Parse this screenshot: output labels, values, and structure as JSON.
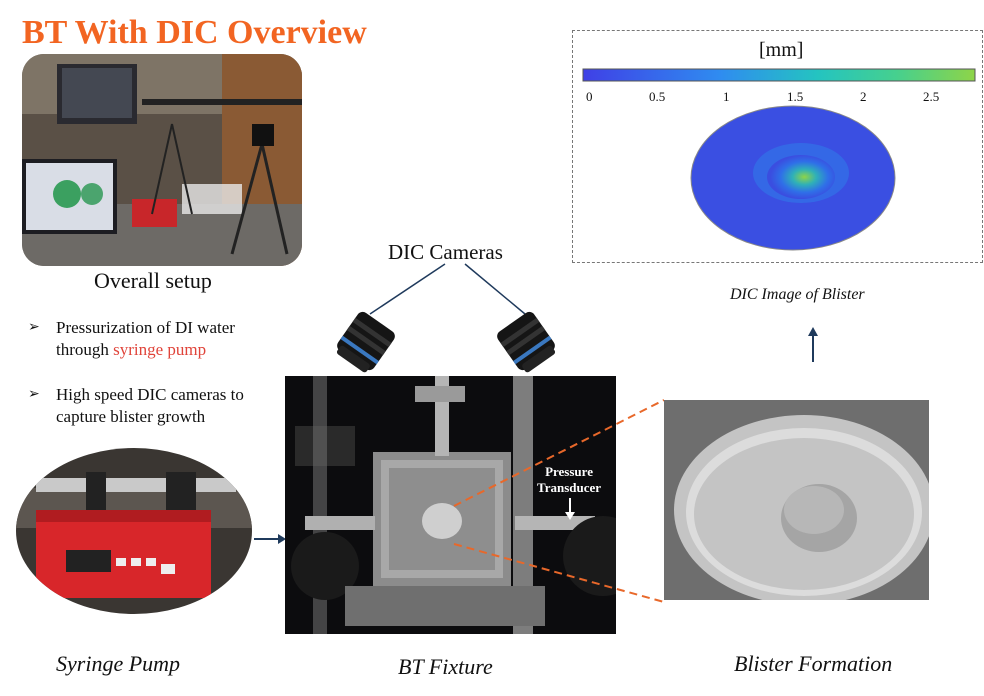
{
  "title": "BT With DIC Overview",
  "overall_setup": {
    "caption": "Overall setup"
  },
  "bullets": [
    {
      "line1": "Pressurization of DI water",
      "line2_prefix": "through ",
      "line2_highlight": "syringe pump"
    },
    {
      "line1": "High speed DIC cameras to",
      "line2": "capture blister growth"
    }
  ],
  "dic_cameras_label": "DIC Cameras",
  "dic_image": {
    "colorbar_unit": "[mm]",
    "ticks": [
      "0",
      "0.5",
      "1",
      "1.5",
      "2",
      "2.5"
    ],
    "caption": "DIC Image of Blister"
  },
  "fixture": {
    "pressure_transducer_label": [
      "Pressure",
      "Transducer"
    ],
    "caption": "BT Fixture"
  },
  "syringe_pump": {
    "caption": "Syringe Pump"
  },
  "blister_formation": {
    "caption": "Blister Formation"
  },
  "colors": {
    "title": "#f26522",
    "highlight": "#e0443a",
    "arrow": "#1f3a5c",
    "dashed": "#e8682a"
  }
}
